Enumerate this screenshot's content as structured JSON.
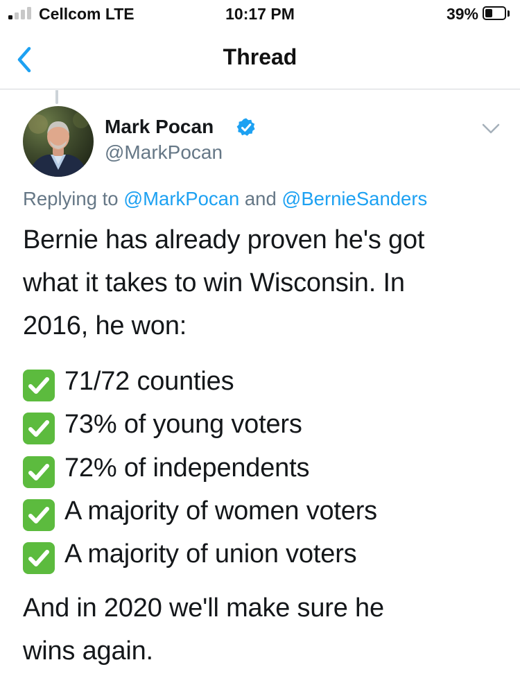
{
  "status_bar": {
    "carrier": "Cellcom  LTE",
    "time": "10:17 PM",
    "battery_percent": "39%",
    "battery_level": 0.39,
    "signal_bars_active": 1,
    "signal_bars_total": 4
  },
  "nav": {
    "title": "Thread",
    "back_icon": "chevron-left-icon"
  },
  "tweet": {
    "author_name": "Mark Pocan",
    "verified": true,
    "handle": "@MarkPocan",
    "reply": {
      "prefix": "Replying to ",
      "mention_1": "@MarkPocan",
      "joiner": " and ",
      "mention_2": "@BernieSanders"
    },
    "text_lines": [
      "Bernie has already proven he's got",
      "what it takes to win Wisconsin. In",
      "2016, he won:"
    ],
    "bullets": [
      "71/72 counties",
      "73% of young voters",
      "72% of independents",
      "A majority of women voters",
      "A majority of union voters"
    ],
    "closing_lines": [
      "And in 2020 we'll make sure he",
      "wins again."
    ]
  },
  "colors": {
    "link": "#1da1f2",
    "secondary_text": "#657786",
    "check_green": "#5cbb3e",
    "verified_blue": "#1da1f2"
  }
}
